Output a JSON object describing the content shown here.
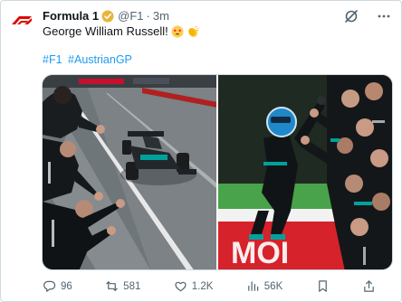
{
  "account": {
    "name": "Formula 1",
    "handle": "@F1",
    "separator": "·",
    "time": "3m"
  },
  "tweet": {
    "text": "George William Russell!",
    "emojis": [
      "star-struck-emoji",
      "clapping-hands-emoji"
    ],
    "hashtags": [
      "#F1",
      "#AustrianGP"
    ]
  },
  "media": {
    "left_photo": "Team members leaning over pit wall cheering as black Mercedes car crosses finish line",
    "right_photo": "Driver in helmet climbing up to celebrate with team members"
  },
  "actions": {
    "replies": "96",
    "reposts": "581",
    "likes": "1.2K",
    "views": "56K"
  },
  "colors": {
    "brand": "#e10600",
    "link": "#1d9bf0",
    "muted": "#536471",
    "verified": "#e8b43a"
  },
  "icons": {
    "grok": "grok-icon",
    "more": "more-icon",
    "reply": "reply-icon",
    "repost": "repost-icon",
    "like": "like-icon",
    "views": "views-icon",
    "bookmark": "bookmark-icon",
    "share": "share-icon"
  }
}
